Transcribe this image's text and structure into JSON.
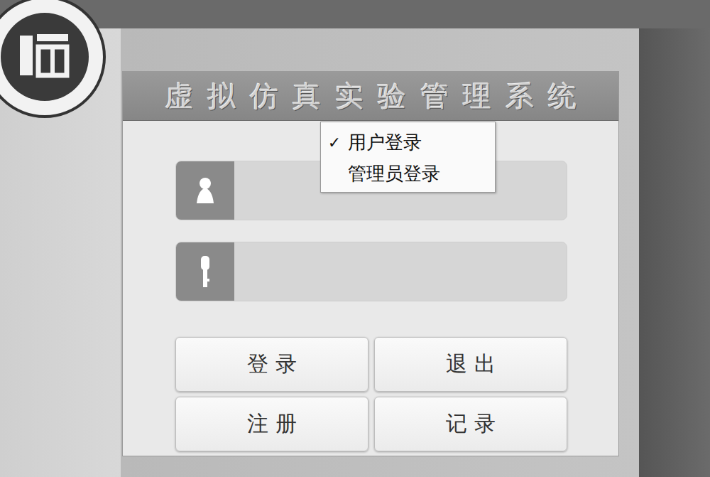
{
  "window": {
    "title": "虚拟仿真实验管理系统"
  },
  "login_mode_menu": {
    "check_mark": "✓",
    "items": [
      {
        "label": "用户登录",
        "checked": true
      },
      {
        "label": "管理员登录",
        "checked": false
      }
    ]
  },
  "fields": [
    {
      "kind": "username",
      "value": ""
    },
    {
      "kind": "password",
      "value": ""
    }
  ],
  "buttons": [
    "登 录",
    "退 出",
    "注 册",
    "记 录"
  ]
}
